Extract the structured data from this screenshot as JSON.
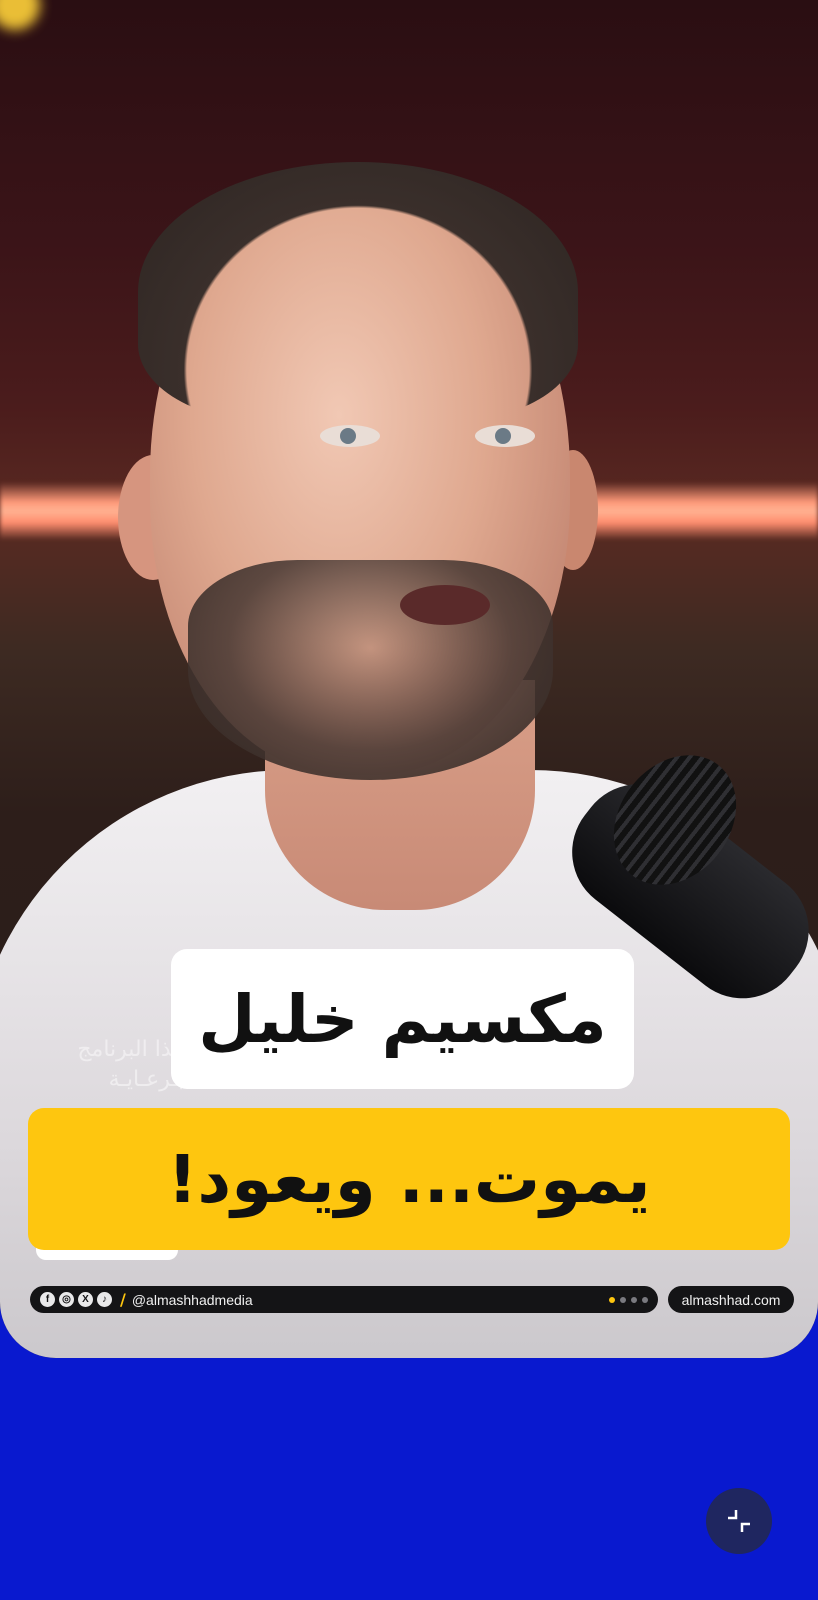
{
  "overlay": {
    "name_title": "مكسيم خليل",
    "headline": "يموت... ويعود!",
    "sponsor_line1": "هذا البرنامج",
    "sponsor_line2": "بـرعـايـة"
  },
  "footer": {
    "social_icons": [
      "facebook-icon",
      "instagram-icon",
      "x-icon",
      "tiktok-icon"
    ],
    "handle": "@almashhadmedia",
    "page_dots": 4,
    "active_dot": 0,
    "domain": "almashhad.com"
  },
  "controls": {
    "exit_fullscreen_icon": "exit-fullscreen-icon"
  },
  "colors": {
    "background": "#0919cf",
    "headline_bg": "#fec60f",
    "name_bg": "#ffffff",
    "bar_bg": "#141416"
  }
}
